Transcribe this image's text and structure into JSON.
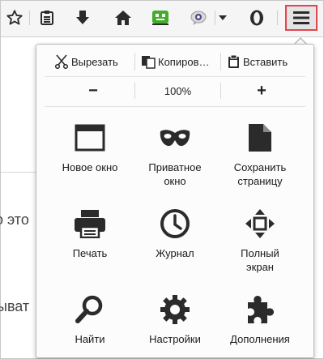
{
  "toolbar": {
    "icons": [
      "star-icon",
      "reading-list-icon",
      "download-icon",
      "home-icon",
      "addon-green-icon",
      "chat-bubble-icon",
      "dropdown-arrow-icon",
      "opera-o-icon",
      "hamburger-menu-icon"
    ]
  },
  "background": {
    "fragment_1": "о это",
    "fragment_2": "ыват"
  },
  "menu": {
    "edit": {
      "cut": "Вырезать",
      "copy": "Копиров…",
      "paste": "Вставить"
    },
    "zoom": {
      "minus": "−",
      "level": "100%",
      "plus": "+"
    },
    "items": [
      {
        "label": "Новое окно",
        "icon": "new-window-icon"
      },
      {
        "label": "Приватное окно",
        "icon": "private-mask-icon"
      },
      {
        "label": "Сохранить страницу",
        "icon": "save-page-icon"
      },
      {
        "label": "Печать",
        "icon": "printer-icon"
      },
      {
        "label": "Журнал",
        "icon": "history-clock-icon"
      },
      {
        "label": "Полный экран",
        "icon": "fullscreen-icon"
      },
      {
        "label": "Найти",
        "icon": "find-magnifier-icon"
      },
      {
        "label": "Настройки",
        "icon": "settings-gear-icon"
      },
      {
        "label": "Дополнения",
        "icon": "addons-puzzle-icon"
      }
    ]
  },
  "colors": {
    "highlight_border": "#e0474c",
    "addon_green": "#3fae29",
    "icon_dark": "#2b2b2b"
  }
}
